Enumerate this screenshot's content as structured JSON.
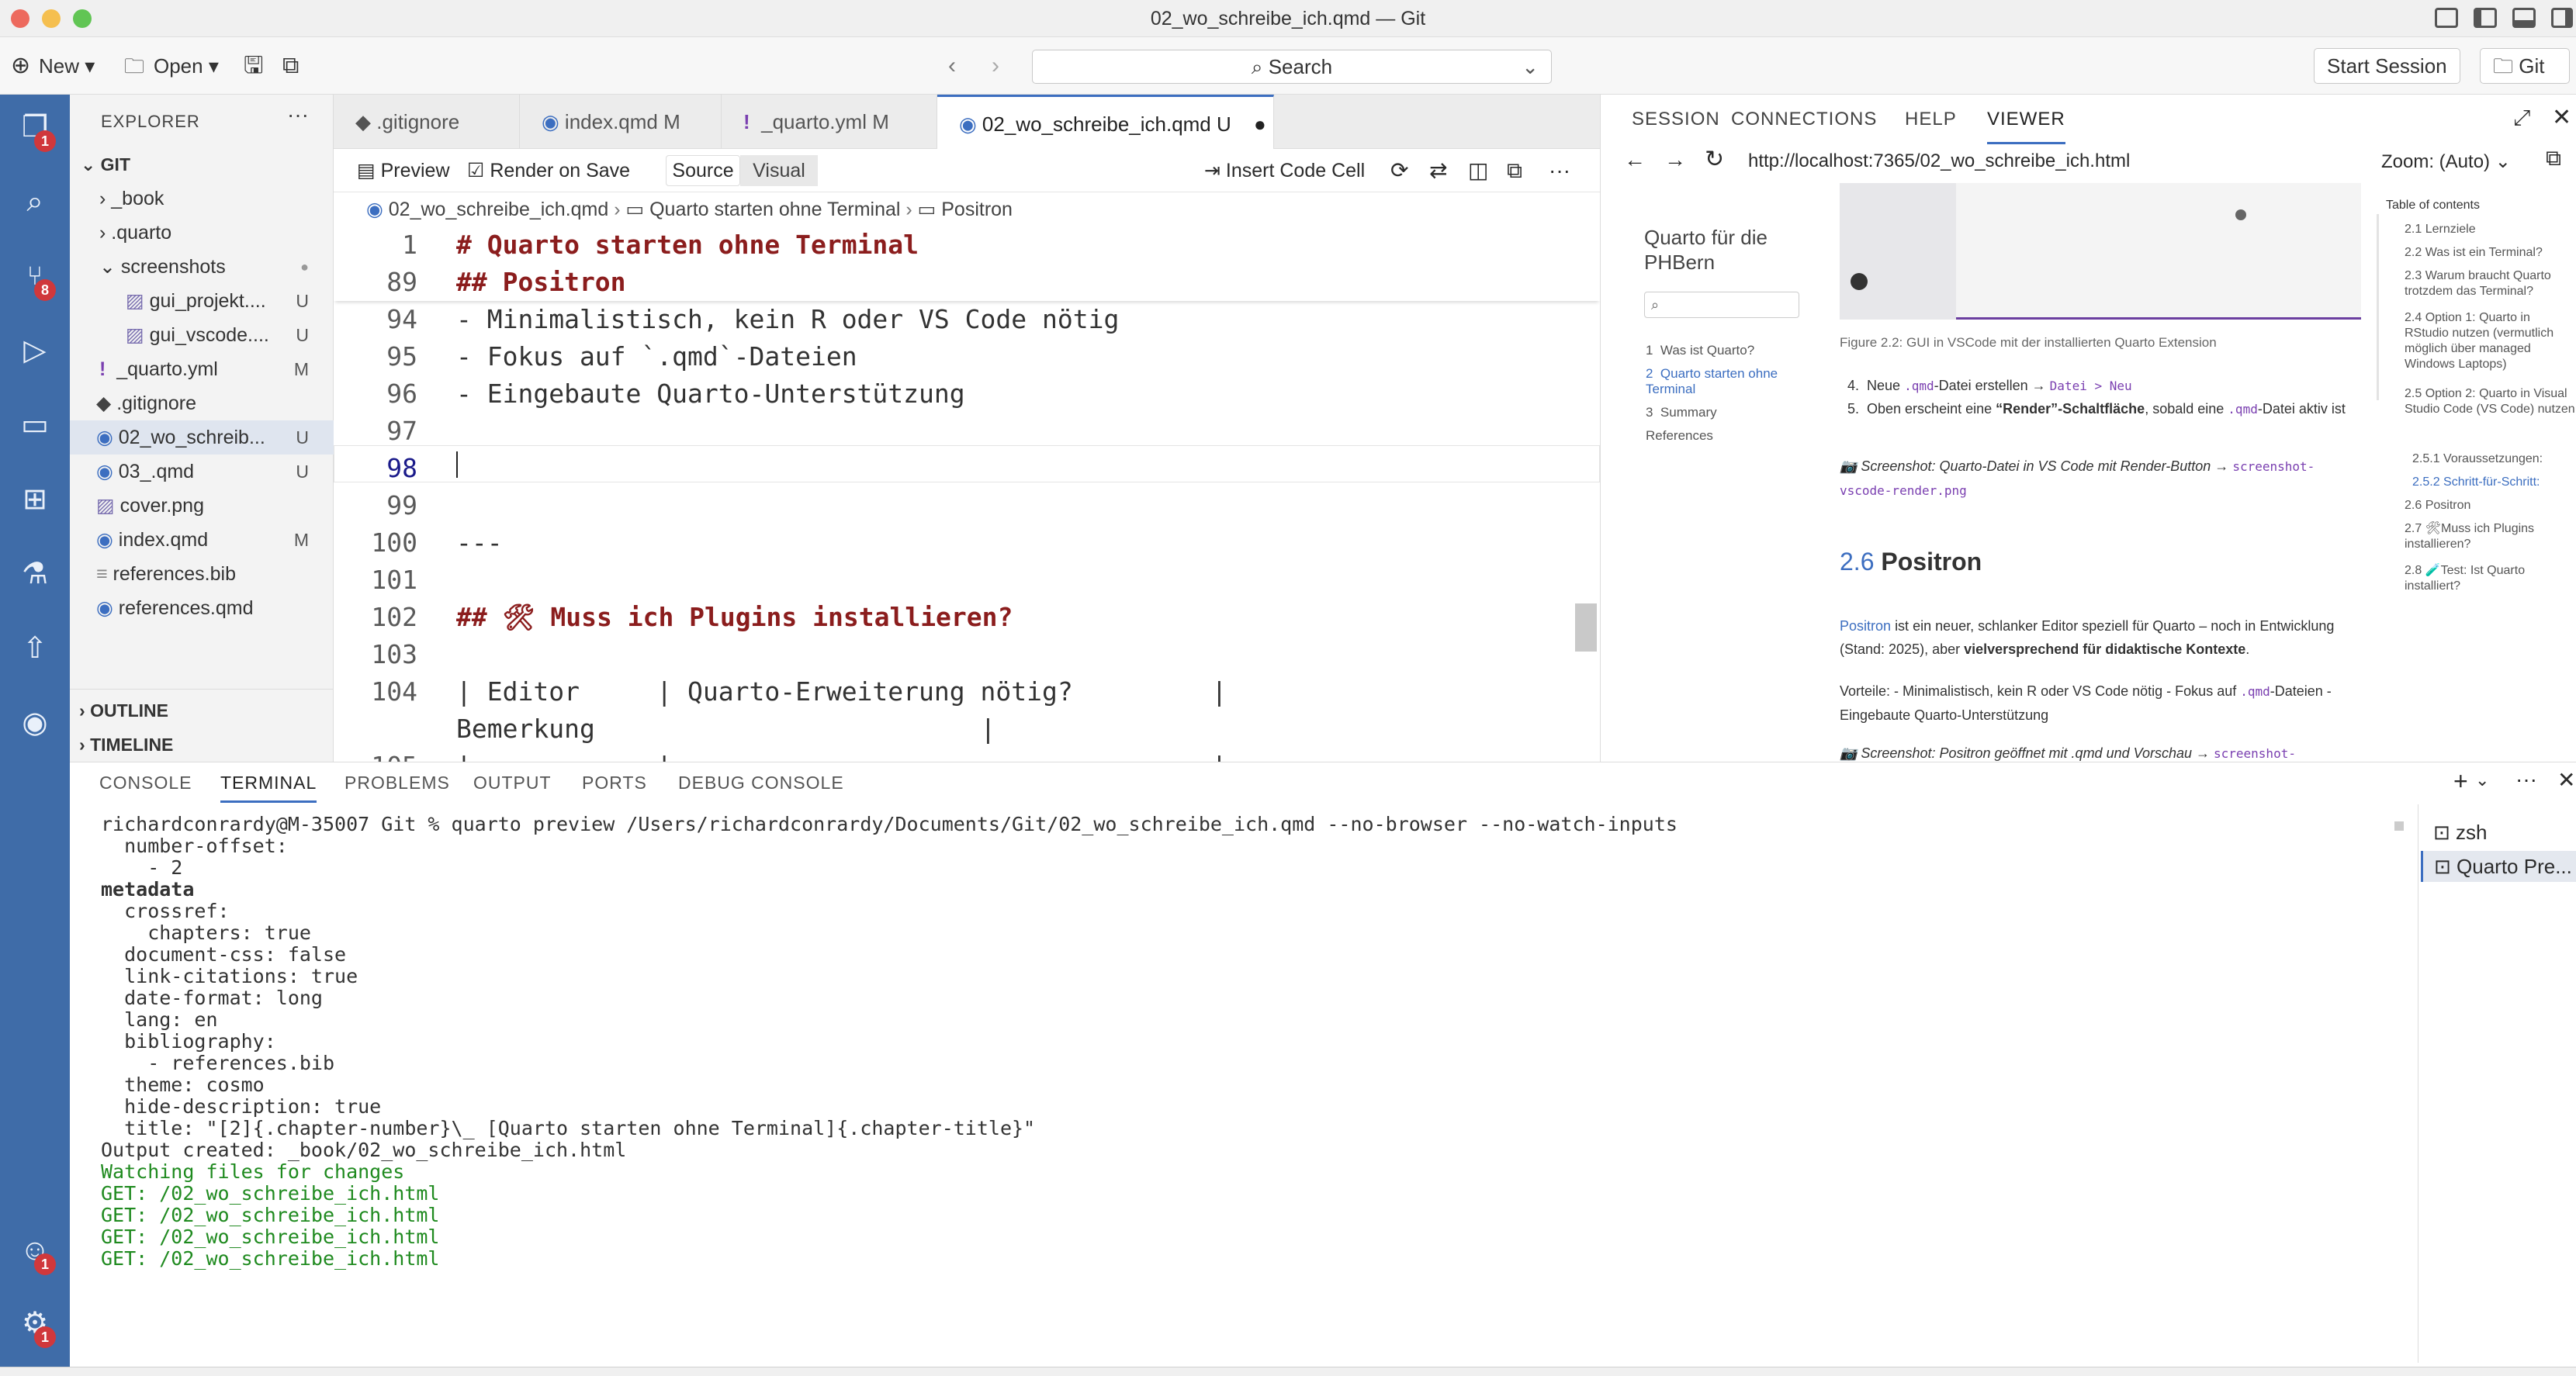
{
  "window": {
    "title": "02_wo_schreibe_ich.qmd — Git"
  },
  "toolbar": {
    "new_label": "New",
    "open_label": "Open",
    "search_placeholder": "Search",
    "start_session_label": "Start Session",
    "git_label": "Git"
  },
  "activity": {
    "explorer_badge": "1",
    "scm_badge": "8",
    "account_badge": "1",
    "settings_badge": "1"
  },
  "explorer": {
    "title": "EXPLORER",
    "root": "GIT",
    "items": [
      {
        "label": "_book",
        "status": ""
      },
      {
        "label": ".quarto",
        "status": ""
      },
      {
        "label": "screenshots",
        "status": "●"
      },
      {
        "label": "gui_projekt....",
        "status": "U"
      },
      {
        "label": "gui_vscode....",
        "status": "U"
      },
      {
        "label": "_quarto.yml",
        "status": "M"
      },
      {
        "label": ".gitignore",
        "status": ""
      },
      {
        "label": "02_wo_schreib...",
        "status": "U"
      },
      {
        "label": "03_.qmd",
        "status": "U"
      },
      {
        "label": "cover.png",
        "status": ""
      },
      {
        "label": "index.qmd",
        "status": "M"
      },
      {
        "label": "references.bib",
        "status": ""
      },
      {
        "label": "references.qmd",
        "status": ""
      }
    ],
    "outline": "OUTLINE",
    "timeline": "TIMELINE"
  },
  "editor": {
    "tabs": [
      {
        "label": ".gitignore",
        "status": ""
      },
      {
        "label": "index.qmd",
        "status": "M"
      },
      {
        "label": "_quarto.yml",
        "status": "M"
      },
      {
        "label": "02_wo_schreibe_ich.qmd",
        "status": "U"
      }
    ],
    "preview_label": "Preview",
    "render_on_save_label": "Render on Save",
    "source_label": "Source",
    "visual_label": "Visual",
    "insert_code_cell_label": "Insert Code Cell",
    "breadcrumbs": [
      "02_wo_schreibe_ich.qmd",
      "Quarto starten ohne Terminal",
      "Positron"
    ],
    "lines": [
      {
        "n": "1",
        "text": "# Quarto starten ohne Terminal"
      },
      {
        "n": "89",
        "text": "## Positron"
      },
      {
        "n": "94",
        "text": "- Minimalistisch, kein R oder VS Code nötig"
      },
      {
        "n": "95",
        "text": "- Fokus auf `.qmd`-Dateien"
      },
      {
        "n": "96",
        "text": "- Eingebaute Quarto-Unterstützung"
      },
      {
        "n": "97",
        "text": ""
      },
      {
        "n": "98",
        "text": ""
      },
      {
        "n": "99",
        "text": ""
      },
      {
        "n": "100",
        "text": "---"
      },
      {
        "n": "101",
        "text": ""
      },
      {
        "n": "102",
        "text": "## 🛠 Muss ich Plugins installieren?"
      },
      {
        "n": "103",
        "text": ""
      },
      {
        "n": "104",
        "text": "| Editor     | Quarto-Erweiterung nötig?         |"
      },
      {
        "n": "",
        "text": "Bemerkung                         |"
      },
      {
        "n": "105",
        "text": "|            |                                   |"
      }
    ]
  },
  "viewer": {
    "tabs": [
      "SESSION",
      "CONNECTIONS",
      "HELP",
      "VIEWER"
    ],
    "url": "http://localhost:7365/02_wo_schreibe_ich.html",
    "zoom": "Zoom: (Auto)",
    "book_title": "Quarto für die PHBern",
    "nav": [
      {
        "num": "1",
        "label": "Was ist Quarto?"
      },
      {
        "num": "2",
        "label": "Quarto starten ohne Terminal"
      },
      {
        "num": "3",
        "label": "Summary"
      },
      {
        "num": "",
        "label": "References"
      }
    ],
    "figure_caption": "Figure 2.2: GUI in VSCode mit der installierten Quarto Extension",
    "list_4_a": "Neue",
    "list_4_code": ".qmd",
    "list_4_b": "-Datei erstellen →",
    "list_4_path": "Datei > Neu",
    "list_5_a": "Oben erscheint eine",
    "list_5_bold": "“Render”-Schaltfläche",
    "list_5_b": ", sobald eine",
    "list_5_code": ".qmd",
    "list_5_c": "-Datei aktiv ist",
    "shot1_text": "📷 Screenshot: Quarto-Datei in VS Code mit Render-Button →",
    "shot1_file": "screenshot-vscode-render.png",
    "section_num": "2.6",
    "section_title": "Positron",
    "p1_link": "Positron",
    "p1_a": "ist ein neuer, schlanker Editor speziell für Quarto – noch in Entwicklung (Stand: 2025), aber",
    "p1_bold": "vielversprechend für didaktische Kontexte",
    "p1_end": ".",
    "p2_a": "Vorteile: - Minimalistisch, kein R oder VS Code nötig - Fokus auf",
    "p2_code": ".qmd",
    "p2_b": "-Dateien - Eingebaute Quarto-Unterstützung",
    "shot2_text": "📷 Screenshot: Positron geöffnet mit .qmd und Vorschau →",
    "shot2_file": "screenshot-",
    "toc_title": "Table of contents",
    "toc": [
      "2.1 Lernziele",
      "2.2 Was ist ein Terminal?",
      "2.3 Warum braucht Quarto trotzdem das Terminal?",
      "2.4 Option 1: Quarto in RStudio nutzen (vermutlich möglich über managed Windows Laptops)",
      "2.5 Option 2: Quarto in Visual Studio Code (VS Code) nutzen",
      "2.5.1 Voraussetzungen:",
      "2.5.2 Schritt-für-Schritt:",
      "2.6 Positron",
      "2.7 🛠Muss ich Plugins installieren?",
      "2.8 🧪Test: Ist Quarto installiert?"
    ]
  },
  "panel": {
    "tabs": [
      "CONSOLE",
      "TERMINAL",
      "PROBLEMS",
      "OUTPUT",
      "PORTS",
      "DEBUG CONSOLE"
    ],
    "terminals": [
      "zsh",
      "Quarto Pre..."
    ],
    "lines": [
      "richardconrardy@M-35007 Git % quarto preview /Users/richardconrardy/Documents/Git/02_wo_schreibe_ich.qmd --no-browser --no-watch-inputs",
      "  number-offset:",
      "    - 2",
      "",
      "metadata",
      "  crossref:",
      "    chapters: true",
      "  document-css: false",
      "  link-citations: true",
      "  date-format: long",
      "  lang: en",
      "  bibliography:",
      "    - references.bib",
      "  theme: cosmo",
      "  hide-description: true",
      "  title: \"[2]{.chapter-number}\\_ [Quarto starten ohne Terminal]{.chapter-title}\"",
      "",
      "Output created: _book/02_wo_schreibe_ich.html",
      "",
      "Watching files for changes",
      "GET: /02_wo_schreibe_ich.html",
      "GET: /02_wo_schreibe_ich.html",
      "GET: /02_wo_schreibe_ich.html",
      "GET: /02_wo_schreibe_ich.html"
    ]
  }
}
